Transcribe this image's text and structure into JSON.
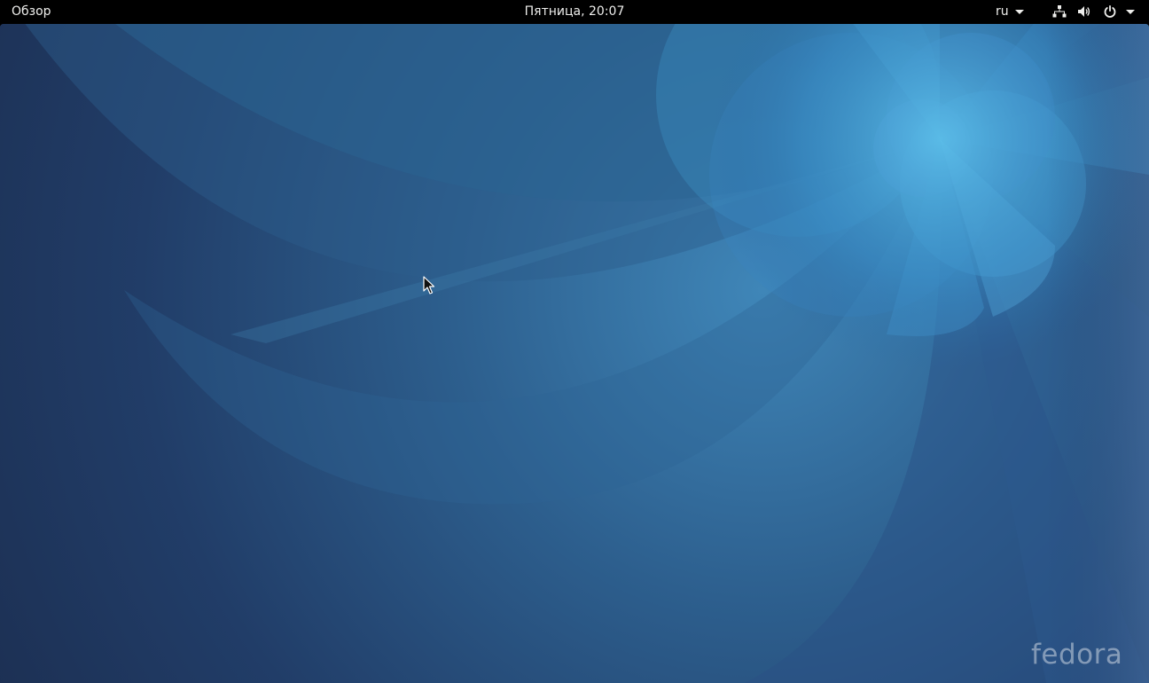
{
  "topbar": {
    "activities_label": "Обзор",
    "clock": "Пятница, 20:07",
    "keyboard_layout": "ru",
    "status_icons": [
      "network-wired-icon",
      "volume-icon",
      "power-icon"
    ],
    "menu_arrow_icon": "chevron-down-icon"
  },
  "desktop": {
    "wallpaper_logo": "fedora",
    "colors": {
      "base": "#1e3558",
      "accent_light": "#3fa6d8",
      "accent_mid": "#2b6ea0"
    }
  }
}
